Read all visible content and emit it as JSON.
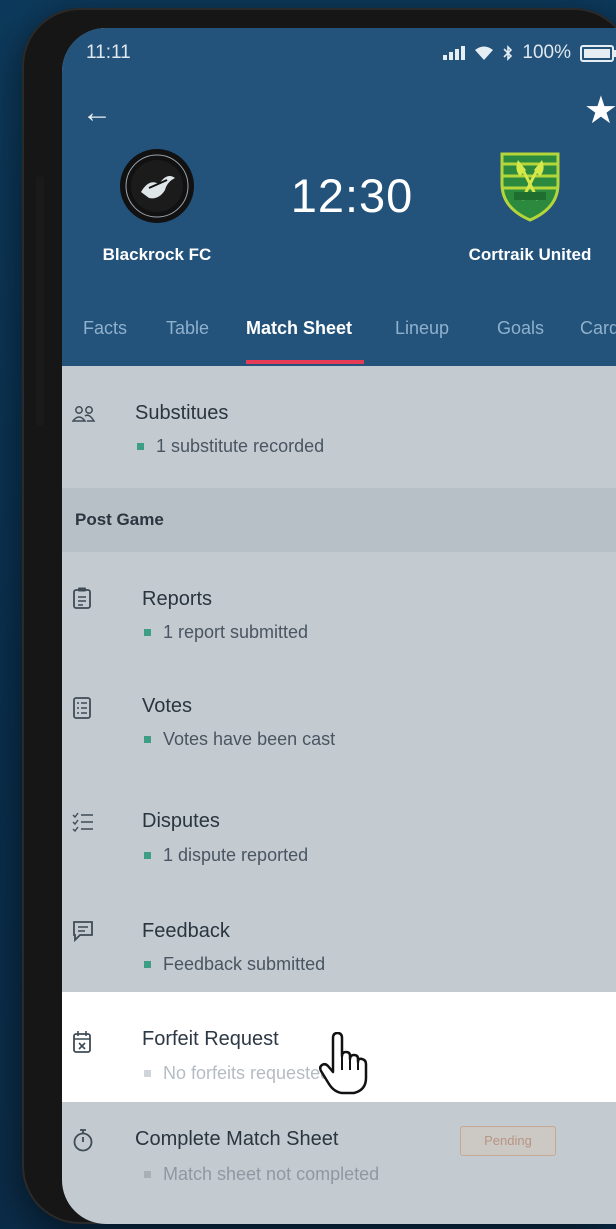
{
  "status_bar": {
    "time": "11:11",
    "battery": "100%"
  },
  "match": {
    "home_team": "Blackrock FC",
    "away_team": "Cortraik United",
    "kickoff_time": "12:30"
  },
  "tabs": [
    {
      "label": "Facts"
    },
    {
      "label": "Table"
    },
    {
      "label": "Match Sheet"
    },
    {
      "label": "Lineup"
    },
    {
      "label": "Goals"
    },
    {
      "label": "Cards"
    }
  ],
  "active_tab": "Match Sheet",
  "substitutes": {
    "title": "Substitues",
    "status": "1 substitute recorded"
  },
  "post_game_heading": "Post Game",
  "post_game_items": [
    {
      "title": "Reports",
      "status": "1 report submitted",
      "icon": "clipboard-icon"
    },
    {
      "title": "Votes",
      "status": "Votes have been cast",
      "icon": "ballot-list-icon"
    },
    {
      "title": "Disputes",
      "status": "1 dispute reported",
      "icon": "checklist-icon"
    },
    {
      "title": "Feedback",
      "status": "Feedback submitted",
      "icon": "message-icon"
    },
    {
      "title": "Forfeit Request",
      "status": "No forfeits requested",
      "icon": "calendar-x-icon"
    },
    {
      "title": "Complete Match Sheet",
      "status": "Match sheet not completed",
      "badge": "Pending",
      "icon": "stopwatch-icon"
    }
  ],
  "colors": {
    "header": "#23527a",
    "active_tab_underline": "#e63b55",
    "status_dot": "#3d9e84",
    "list_background": "#c3cbd1"
  }
}
